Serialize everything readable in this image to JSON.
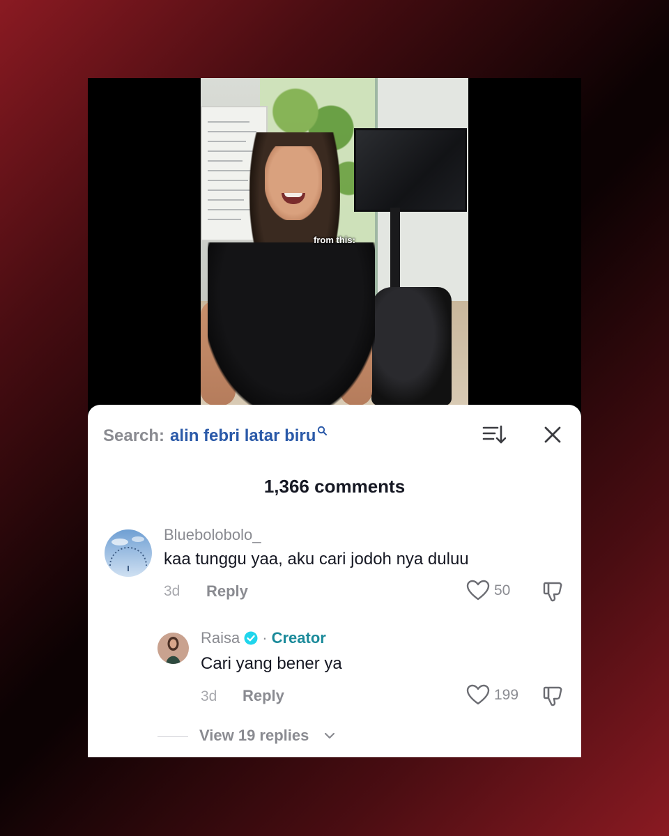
{
  "video": {
    "caption": "from this:"
  },
  "comments_panel": {
    "search": {
      "prefix": "Search:",
      "query": "alin febri latar biru"
    },
    "sort_icon": "sort-icon",
    "close_icon": "close-icon",
    "count_label": "1,366 comments",
    "comments": [
      {
        "username": "Bluebolobolo_",
        "text": "kaa tunggu yaa, aku cari jodoh nya duluu",
        "time": "3d",
        "reply_label": "Reply",
        "likes": "50"
      }
    ],
    "reply": {
      "username": "Raisa",
      "badge": "Creator",
      "text": "Cari yang bener ya",
      "time": "3d",
      "reply_label": "Reply",
      "likes": "199"
    },
    "view_replies_label": "View 19 replies"
  },
  "colors": {
    "accent_blue": "#2a59a8",
    "creator_teal": "#1a8a9a",
    "verified_blue": "#20d5ec"
  }
}
